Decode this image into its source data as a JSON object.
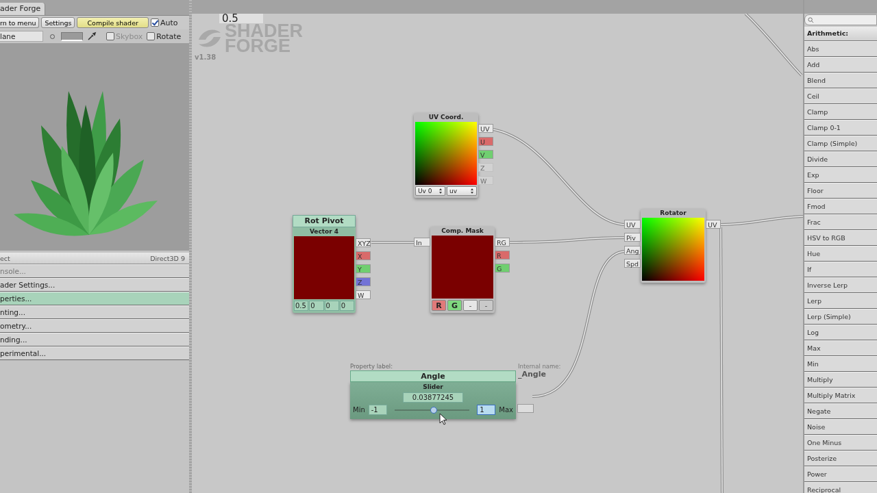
{
  "left_panel": {
    "tab": "ader Forge",
    "toolbar": [
      {
        "kind": "button",
        "label": "rn to menu"
      },
      {
        "kind": "button",
        "label": "Settings"
      },
      {
        "kind": "accent",
        "label": "Compile shader"
      },
      {
        "kind": "checkbox",
        "label": "Auto",
        "checked": true
      }
    ],
    "preview_bar": {
      "mesh": "lane",
      "skybox": {
        "label": "Skybox",
        "checked": false,
        "disabled": true
      },
      "rotate": {
        "label": "Rotate",
        "checked": false,
        "disabled": false
      }
    },
    "header": {
      "left": "ect",
      "right": "Direct3D 9"
    },
    "sections": [
      {
        "label": "nsole...",
        "selected": false,
        "disabled": true
      },
      {
        "label": "ader Settings...",
        "selected": false,
        "disabled": false
      },
      {
        "label": "perties...",
        "selected": true,
        "disabled": false
      },
      {
        "label": "nting...",
        "selected": false,
        "disabled": false
      },
      {
        "label": "ometry...",
        "selected": false,
        "disabled": false
      },
      {
        "label": "nding...",
        "selected": false,
        "disabled": false
      },
      {
        "label": "perimental...",
        "selected": false,
        "disabled": false
      }
    ]
  },
  "canvas": {
    "top_value": "0.5",
    "logo": [
      "SHADER",
      "FORGE"
    ],
    "version": "v1.38",
    "nodes": [
      {
        "kind": "uv",
        "title": "UV Coord.",
        "dropdowns": [
          "Uv 0",
          "uv"
        ],
        "outputs": [
          {
            "label": "UV",
            "color": "#e8e8e8",
            "disabled": false
          },
          {
            "label": "U",
            "color": "#d96a6a",
            "disabled": false
          },
          {
            "label": "V",
            "color": "#70cf70",
            "disabled": false
          },
          {
            "label": "Z",
            "color": "#d2d2d2",
            "disabled": true
          },
          {
            "label": "W",
            "color": "#d2d2d2",
            "disabled": true
          }
        ]
      },
      {
        "kind": "vector",
        "label": "Rot Pivot",
        "title": "Vector 4",
        "values": [
          "0.5",
          "0",
          "0",
          "0"
        ],
        "outputs": [
          {
            "label": "XYZ",
            "color": "#e8e8e8",
            "disabled": false
          },
          {
            "label": "X",
            "color": "#d96a6a",
            "disabled": false
          },
          {
            "label": "Y",
            "color": "#70cf70",
            "disabled": false
          },
          {
            "label": "Z",
            "color": "#7272d6",
            "disabled": false
          },
          {
            "label": "W",
            "color": "#ececec",
            "disabled": false
          }
        ]
      },
      {
        "kind": "mask",
        "title": "Comp. Mask",
        "inputs": [
          {
            "label": "In"
          }
        ],
        "outputs": [
          {
            "label": "RG",
            "color": "#e8e8e8",
            "disabled": false
          },
          {
            "label": "R",
            "color": "#d96a6a",
            "disabled": false
          },
          {
            "label": "G",
            "color": "#70cf70",
            "disabled": false
          }
        ],
        "channels": [
          {
            "label": "R",
            "color": "#e07a7a",
            "selected": true
          },
          {
            "label": "G",
            "color": "#7fd87f",
            "selected": true
          },
          {
            "label": "-",
            "color": "#e6e6e6",
            "selected": false
          },
          {
            "label": "-",
            "color": "#c9c9c9",
            "selected": false
          }
        ]
      },
      {
        "kind": "rotator",
        "title": "Rotator",
        "inputs": [
          {
            "label": "UV"
          },
          {
            "label": "Piv"
          },
          {
            "label": "Ang"
          },
          {
            "label": "Spd"
          }
        ],
        "outputs": [
          {
            "label": "UV",
            "color": "#e8e8e8",
            "disabled": false
          }
        ]
      },
      {
        "kind": "slider",
        "caption": "Property label:",
        "label": "Angle",
        "title": "Slider",
        "value": "0.03877245",
        "min_label": "Min",
        "min": "-1",
        "max": "1",
        "max_label": "Max",
        "level": 0.52,
        "internal_caption": "Internal name:",
        "internal_name": "_Angle"
      }
    ]
  },
  "node_list": {
    "category": "Arithmetic:",
    "items": [
      "Abs",
      "Add",
      "Blend",
      "Ceil",
      "Clamp",
      "Clamp 0-1",
      "Clamp (Simple)",
      "Divide",
      "Exp",
      "Floor",
      "Fmod",
      "Frac",
      "HSV to RGB",
      "Hue",
      "If",
      "Inverse Lerp",
      "Lerp",
      "Lerp (Simple)",
      "Log",
      "Max",
      "Min",
      "Multiply",
      "Multiply Matrix",
      "Negate",
      "Noise",
      "One Minus",
      "Posterize",
      "Power",
      "Reciprocal"
    ]
  }
}
